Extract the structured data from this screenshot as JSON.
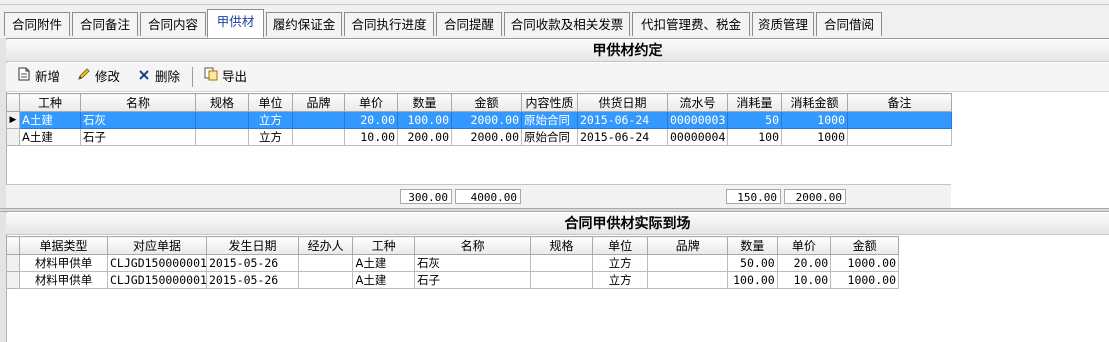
{
  "tabs": [
    {
      "label": "合同附件"
    },
    {
      "label": "合同备注"
    },
    {
      "label": "合同内容"
    },
    {
      "label": "甲供材"
    },
    {
      "label": "履约保证金"
    },
    {
      "label": "合同执行进度"
    },
    {
      "label": "合同提醒"
    },
    {
      "label": "合同收款及相关发票"
    },
    {
      "label": "代扣管理费、税金"
    },
    {
      "label": "资质管理"
    },
    {
      "label": "合同借阅"
    }
  ],
  "active_tab": "甲供材",
  "panel1": {
    "title": "甲供材约定",
    "toolbar": {
      "add_label": "新增",
      "edit_label": "修改",
      "delete_label": "删除",
      "export_label": "导出"
    },
    "columns": [
      "工种",
      "名称",
      "规格",
      "单位",
      "品牌",
      "单价",
      "数量",
      "金额",
      "内容性质",
      "供货日期",
      "流水号",
      "消耗量",
      "消耗金额",
      "备注"
    ],
    "rows": [
      {
        "trade": "A土建",
        "name": "石灰",
        "spec": "",
        "unit": "立方",
        "brand": "",
        "price": "20.00",
        "qty": "100.00",
        "amount": "2000.00",
        "nature": "原始合同",
        "date": "2015-06-24",
        "serial": "00000003",
        "consumed": "50",
        "consumed_amount": "1000",
        "note": ""
      },
      {
        "trade": "A土建",
        "name": "石子",
        "spec": "",
        "unit": "立方",
        "brand": "",
        "price": "10.00",
        "qty": "200.00",
        "amount": "2000.00",
        "nature": "原始合同",
        "date": "2015-06-24",
        "serial": "00000004",
        "consumed": "100",
        "consumed_amount": "1000",
        "note": ""
      }
    ],
    "selected_row": 0,
    "totals": {
      "qty": "300.00",
      "amount": "4000.00",
      "consumed": "150.00",
      "consumed_amount": "2000.00"
    }
  },
  "panel2": {
    "title": "合同甲供材实际到场",
    "columns": [
      "单据类型",
      "对应单据",
      "发生日期",
      "经办人",
      "工种",
      "名称",
      "规格",
      "单位",
      "品牌",
      "数量",
      "单价",
      "金额"
    ],
    "rows": [
      {
        "doc_type": "材料甲供单",
        "doc_no": "CLJGD150000001",
        "date": "2015-05-26",
        "handler": "",
        "trade": "A土建",
        "name": "石灰",
        "spec": "",
        "unit": "立方",
        "brand": "",
        "qty": "50.00",
        "price": "20.00",
        "amount": "1000.00"
      },
      {
        "doc_type": "材料甲供单",
        "doc_no": "CLJGD150000001",
        "date": "2015-05-26",
        "handler": "",
        "trade": "A土建",
        "name": "石子",
        "spec": "",
        "unit": "立方",
        "brand": "",
        "qty": "100.00",
        "price": "10.00",
        "amount": "1000.00"
      }
    ]
  },
  "icons": {
    "add": "document-new-icon",
    "edit": "pencil-icon",
    "delete": "x-icon",
    "export": "export-icon",
    "row_indicator": "triangle-right-icon"
  },
  "colors": {
    "selection": "#3399ff",
    "active_tab_text": "#1d3fa8"
  }
}
